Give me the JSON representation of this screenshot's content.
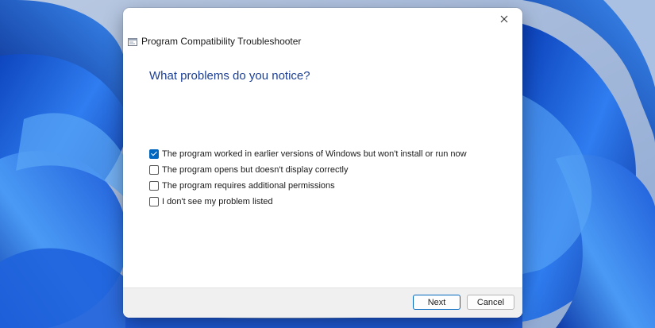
{
  "window": {
    "title": "Program Compatibility Troubleshooter",
    "app_icon": "troubleshooter-window-icon",
    "close_icon": "close-icon"
  },
  "main": {
    "heading": "What problems do you notice?",
    "options": [
      {
        "label": "The program worked in earlier versions of Windows but won't install or run now",
        "checked": true
      },
      {
        "label": "The program opens but doesn't display correctly",
        "checked": false
      },
      {
        "label": "The program requires additional permissions",
        "checked": false
      },
      {
        "label": "I don't see my problem listed",
        "checked": false
      }
    ]
  },
  "footer": {
    "next_label": "Next",
    "cancel_label": "Cancel"
  },
  "colors": {
    "heading": "#1c3f94",
    "accent": "#0067c0",
    "wallpaper_base": "#9ab2d6",
    "wallpaper_blue": "#1a5fd8"
  }
}
